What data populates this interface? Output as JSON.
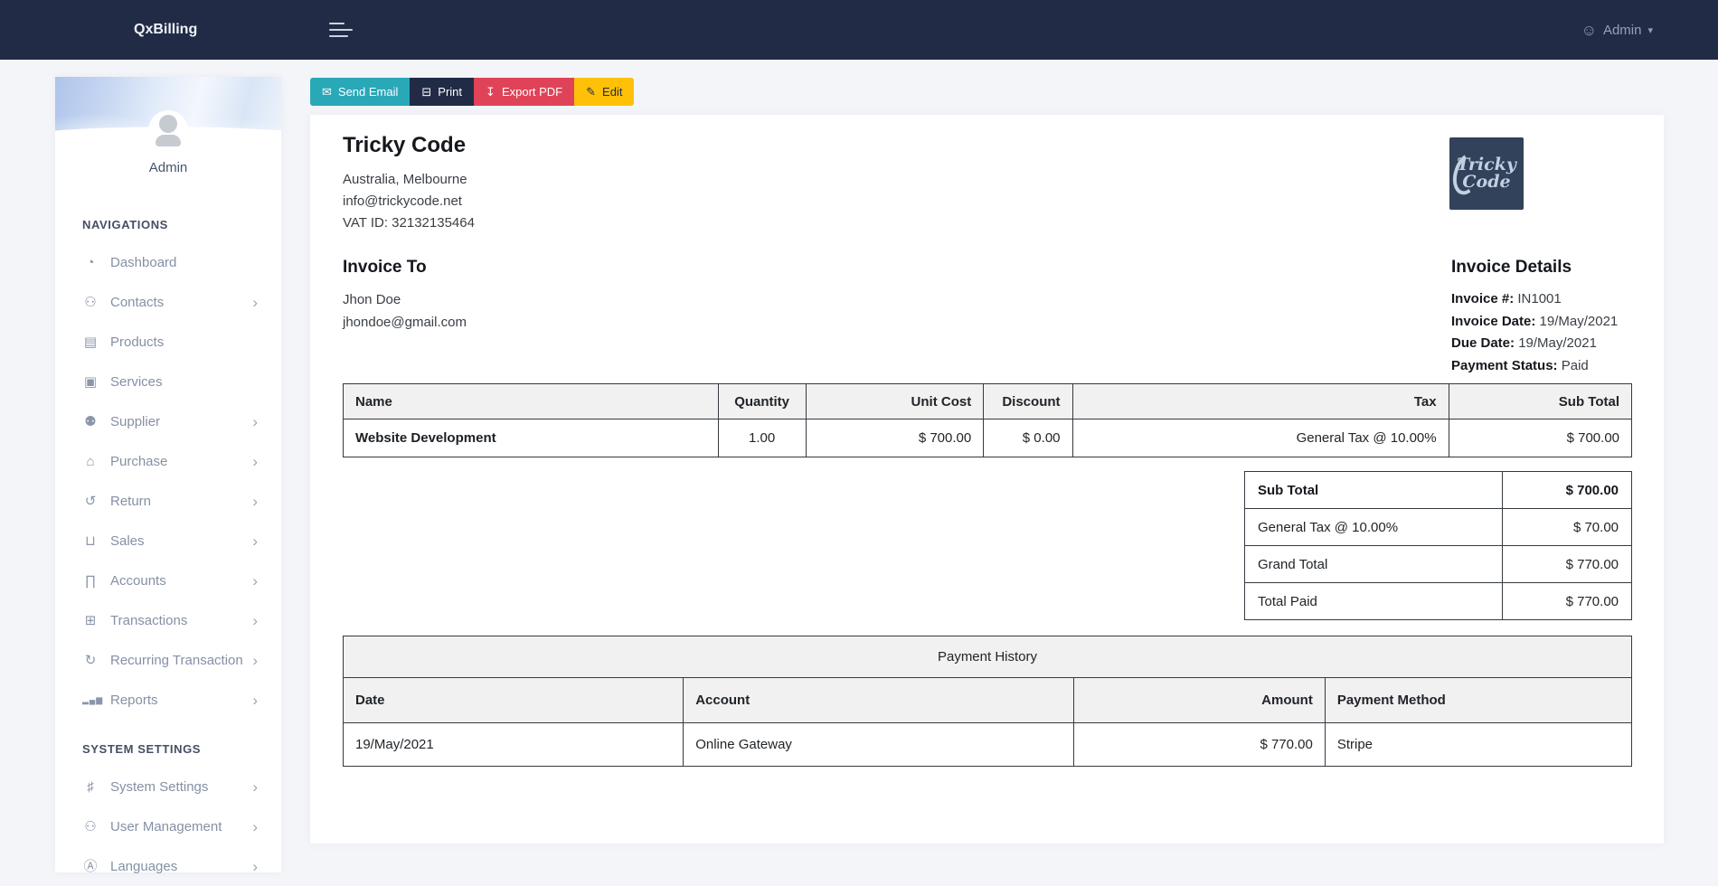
{
  "navbar": {
    "brand": "QxBilling",
    "user_label": "Admin"
  },
  "icons": {
    "hamburger": "css-bars",
    "user_circle": "☺",
    "caret_down": "▾",
    "chevron_right": "›",
    "send_email": "✉",
    "print": "⊟",
    "export_pdf": "↧",
    "edit": "✎",
    "dashboard": "◔",
    "contacts": "⚇",
    "products": "▤",
    "services": "▣",
    "supplier": "⚉",
    "purchase": "⌂",
    "return": "↺",
    "sales": "⊔",
    "accounts": "∏",
    "transactions": "⊞",
    "recurring_transaction": "↻",
    "reports": "▂▄▆",
    "system_settings": "♯",
    "user_management": "⚇",
    "languages": "Ⓐ"
  },
  "sidebar": {
    "profile_name": "Admin",
    "section_navigations": "Navigations",
    "section_system_settings": "System Settings",
    "nav_items": [
      {
        "label": "Dashboard",
        "icon": "◔"
      },
      {
        "label": "Contacts",
        "icon": "⚇"
      },
      {
        "label": "Products",
        "icon": "▤"
      },
      {
        "label": "Services",
        "icon": "▣"
      },
      {
        "label": "Supplier",
        "icon": "⚉"
      },
      {
        "label": "Purchase",
        "icon": "⌂"
      },
      {
        "label": "Return",
        "icon": "↺"
      },
      {
        "label": "Sales",
        "icon": "⊔"
      },
      {
        "label": "Accounts",
        "icon": "∏"
      },
      {
        "label": "Transactions",
        "icon": "⊞"
      },
      {
        "label": "Recurring Transaction",
        "icon": "↻"
      },
      {
        "label": "Reports",
        "icon": "▂▄▆"
      }
    ],
    "settings_items": [
      {
        "label": "System Settings",
        "icon": "♯"
      },
      {
        "label": "User Management",
        "icon": "⚇"
      },
      {
        "label": "Languages",
        "icon": "Ⓐ"
      }
    ],
    "chevron": "›"
  },
  "toolbar": {
    "send_email_label": "Send Email",
    "print_label": "Print",
    "export_pdf_label": "Export PDF",
    "edit_label": "Edit"
  },
  "invoice": {
    "company": {
      "name": "Tricky Code",
      "location": "Australia, Melbourne",
      "email": "info@trickycode.net",
      "vat": "VAT ID: 32132135464"
    },
    "logo": {
      "line1": "Tricky",
      "line2": "Code"
    },
    "invoice_to": {
      "title": "Invoice To",
      "name": "Jhon Doe",
      "email": "jhondoe@gmail.com"
    },
    "details": {
      "title": "Invoice Details",
      "invoice_no_label": "Invoice #:",
      "invoice_no": "IN1001",
      "invoice_date_label": "Invoice Date:",
      "invoice_date": "19/May/2021",
      "due_date_label": "Due Date:",
      "due_date": "19/May/2021",
      "payment_status_label": "Payment Status:",
      "payment_status": "Paid"
    },
    "items_table": {
      "headers": [
        "Name",
        "Quantity",
        "Unit Cost",
        "Discount",
        "Tax",
        "Sub Total"
      ],
      "rows": [
        [
          "Website Development",
          "1.00",
          "$ 700.00",
          "$ 0.00",
          "General Tax @ 10.00%",
          "$ 700.00"
        ]
      ]
    },
    "totals": [
      {
        "label": "Sub Total",
        "value": "$ 700.00"
      },
      {
        "label": "General Tax @ 10.00%",
        "value": "$ 70.00"
      },
      {
        "label": "Grand Total",
        "value": "$ 770.00"
      },
      {
        "label": "Total Paid",
        "value": "$ 770.00"
      }
    ],
    "payment_history": {
      "title": "Payment History",
      "headers": [
        "Date",
        "Account",
        "Amount",
        "Payment Method"
      ],
      "rows": [
        [
          "19/May/2021",
          "Online Gateway",
          "$ 770.00",
          "Stripe"
        ]
      ]
    }
  },
  "colors": {
    "navbar_navy": "#212b46",
    "accent_teal": "#29a8b8",
    "danger_red": "#e04358",
    "warning_yellow": "#ffc108",
    "page_bg": "#f3f5f9",
    "table_border": "#343a40",
    "table_header_bg": "#f1f1f1"
  }
}
